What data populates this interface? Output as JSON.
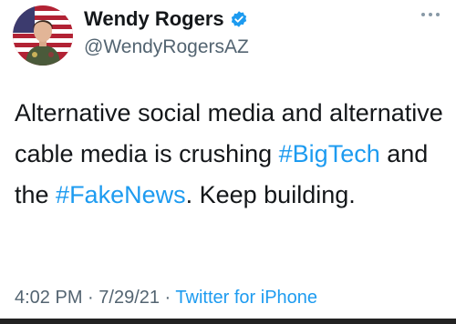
{
  "author": {
    "display_name": "Wendy Rogers",
    "handle": "@WendyRogersAZ",
    "verified_icon": "verified-badge-icon"
  },
  "tweet": {
    "segments": [
      {
        "text": "Alternative social media and alternative cable media is crushing ",
        "type": "text"
      },
      {
        "text": "#BigTech",
        "type": "hashtag"
      },
      {
        "text": " and the ",
        "type": "text"
      },
      {
        "text": "#FakeNews",
        "type": "hashtag"
      },
      {
        "text": ". Keep building.",
        "type": "text"
      }
    ]
  },
  "meta": {
    "time": "4:02 PM",
    "separator": " · ",
    "date": "7/29/21",
    "source": "Twitter for iPhone"
  },
  "colors": {
    "link": "#1d9bf0",
    "secondary": "#536471",
    "text": "#14171a"
  }
}
